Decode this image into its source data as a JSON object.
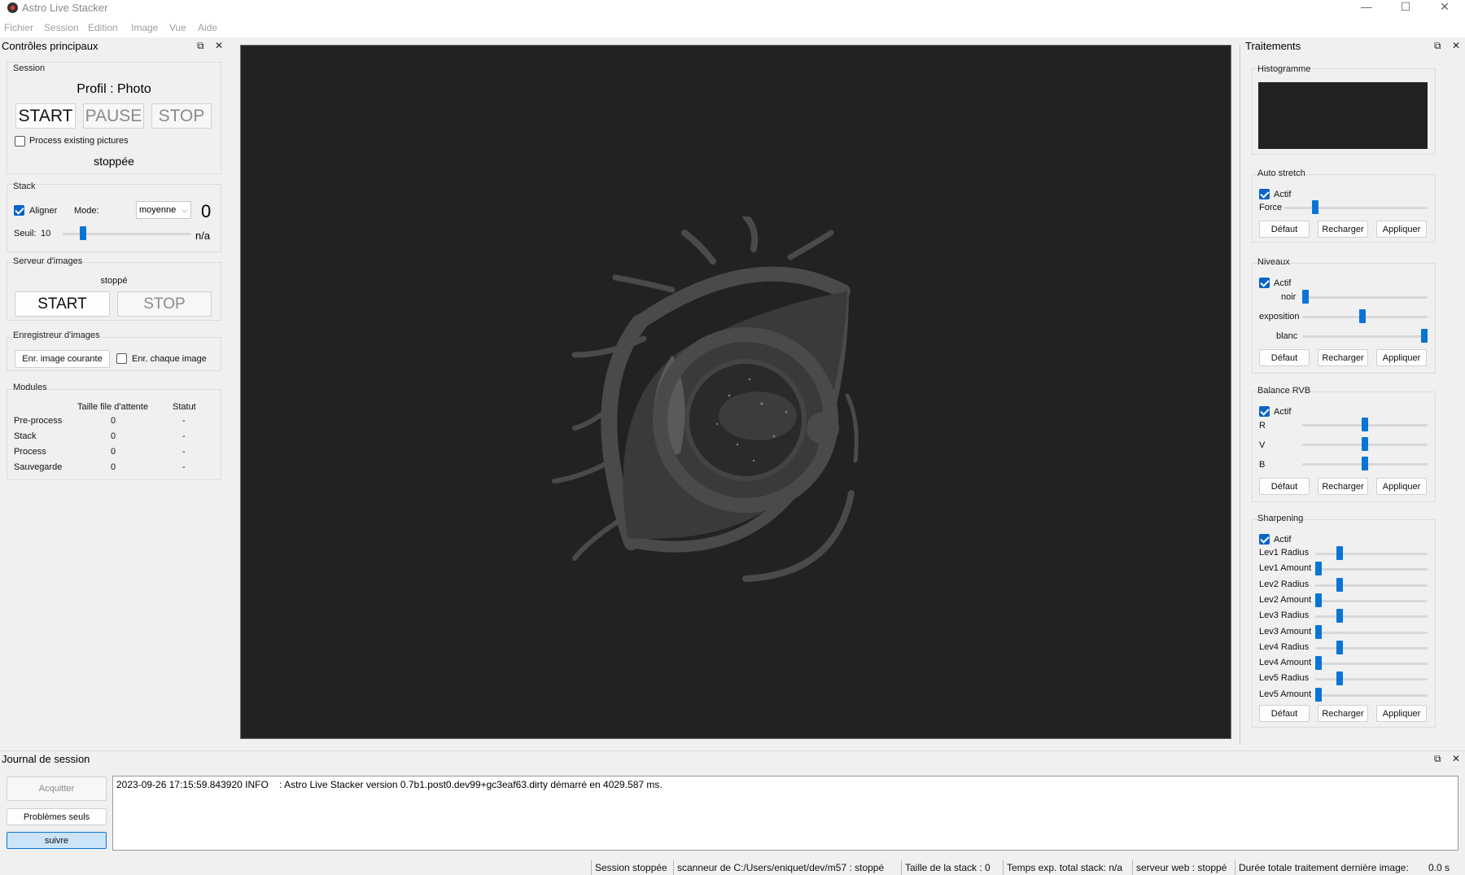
{
  "window": {
    "title": "Astro Live Stacker",
    "minimize": "—",
    "maximize": "☐",
    "close": "✕"
  },
  "menu": [
    "Fichier",
    "Session",
    "Edition",
    "Image",
    "Vue",
    "Aide"
  ],
  "left_dock": {
    "title": "Contrôles principaux",
    "session": {
      "group": "Session",
      "profile": "Profil : Photo",
      "start": "START",
      "pause": "PAUSE",
      "stop": "STOP",
      "process_existing": "Process existing pictures",
      "status": "stoppée"
    },
    "stack": {
      "group": "Stack",
      "align_label": "Aligner",
      "mode_label": "Mode:",
      "mode_value": "moyenne",
      "count": "0",
      "threshold_label": "Seuil:",
      "threshold_value": "10",
      "threshold_fraction": 0.14,
      "na": "n/a"
    },
    "server": {
      "group": "Serveur d'images",
      "status": "stoppé",
      "start": "START",
      "stop": "STOP"
    },
    "recorder": {
      "group": "Enregistreur d'images",
      "save_current": "Enr. image courante",
      "save_each": "Enr. chaque image"
    },
    "modules": {
      "group": "Modules",
      "col_queue": "Taille file d'attente",
      "col_status": "Statut",
      "rows": [
        {
          "name": "Pre-process",
          "queue": "0",
          "status": "-"
        },
        {
          "name": "Stack",
          "queue": "0",
          "status": "-"
        },
        {
          "name": "Process",
          "queue": "0",
          "status": "-"
        },
        {
          "name": "Sauvegarde",
          "queue": "0",
          "status": "-"
        }
      ]
    }
  },
  "right_dock": {
    "title": "Traitements",
    "histogram": {
      "group": "Histogramme"
    },
    "auto_stretch": {
      "group": "Auto stretch",
      "active": "Actif",
      "force": "Force",
      "force_fraction": 0.2
    },
    "levels": {
      "group": "Niveaux",
      "active": "Actif",
      "black": "noir",
      "black_fraction": 0.0,
      "exposure": "exposition",
      "exposure_fraction": 0.48,
      "white": "blanc",
      "white_fraction": 1.0
    },
    "rgb": {
      "group": "Balance RVB",
      "active": "Actif",
      "r": "R",
      "v": "V",
      "b": "B",
      "r_fraction": 0.5,
      "v_fraction": 0.5,
      "b_fraction": 0.5
    },
    "sharpening": {
      "group": "Sharpening",
      "active": "Actif",
      "sliders": [
        {
          "label": "Lev1 Radius",
          "fraction": 0.2
        },
        {
          "label": "Lev1 Amount",
          "fraction": 0.0
        },
        {
          "label": "Lev2 Radius",
          "fraction": 0.2
        },
        {
          "label": "Lev2 Amount",
          "fraction": 0.0
        },
        {
          "label": "Lev3 Radius",
          "fraction": 0.2
        },
        {
          "label": "Lev3 Amount",
          "fraction": 0.0
        },
        {
          "label": "Lev4 Radius",
          "fraction": 0.2
        },
        {
          "label": "Lev4 Amount",
          "fraction": 0.0
        },
        {
          "label": "Lev5 Radius",
          "fraction": 0.2
        },
        {
          "label": "Lev5 Amount",
          "fraction": 0.0
        }
      ]
    },
    "buttons": {
      "default": "Défaut",
      "reload": "Recharger",
      "apply": "Appliquer"
    }
  },
  "journal": {
    "title": "Journal de session",
    "ack": "Acquitter",
    "problems": "Problèmes seuls",
    "follow": "suivre",
    "log": "2023-09-26 17:15:59.843920 INFO    : Astro Live Stacker version 0.7b1.post0.dev99+gc3eaf63.dirty démarré en 4029.587 ms."
  },
  "status_bar": [
    "Session stoppée",
    "scanneur de C:/Users/eniquet/dev/m57 : stoppé",
    "Taille de la stack : 0",
    "Temps exp. total stack: n/a",
    "serveur web : stoppé",
    "Durée totale traitement dernière image:",
    "0.0 s"
  ],
  "colors": {
    "accent": "#0a74d6",
    "viewer_bg": "#222222",
    "logo": "#4a4a4a"
  }
}
